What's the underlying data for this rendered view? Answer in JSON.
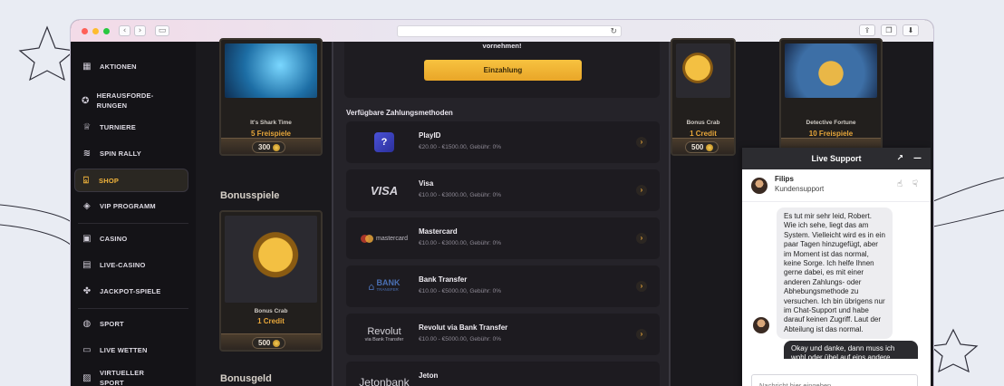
{
  "browser": {
    "traffic_lights": [
      "#ff5f57",
      "#febc2e",
      "#28c840"
    ],
    "back_glyph": "‹",
    "forward_glyph": "›",
    "reload_glyph": "↻",
    "right_icons": [
      "share-icon",
      "tabs-icon",
      "download-icon"
    ]
  },
  "sidebar": {
    "items": [
      {
        "label": "AKTIONEN",
        "icon": "gift-icon",
        "glyph": "▦"
      },
      {
        "label": "HERAUSFORDE-RUNGEN",
        "icon": "medal-icon",
        "glyph": "✪"
      },
      {
        "label": "TURNIERE",
        "icon": "trophy-icon",
        "glyph": "♕"
      },
      {
        "label": "SPIN RALLY",
        "icon": "rally-icon",
        "glyph": "≋"
      },
      {
        "label": "SHOP",
        "icon": "basket-icon",
        "glyph": "⌺",
        "active": true
      },
      {
        "label": "VIP PROGRAMM",
        "icon": "diamond-icon",
        "glyph": "◈"
      },
      {
        "label": "CASINO",
        "icon": "slot-icon",
        "glyph": "▣"
      },
      {
        "label": "LIVE-CASINO",
        "icon": "cards-icon",
        "glyph": "▤"
      },
      {
        "label": "JACKPOT-SPIELE",
        "icon": "clover-icon",
        "glyph": "✤"
      },
      {
        "label": "SPORT",
        "icon": "ball-icon",
        "glyph": "◍"
      },
      {
        "label": "LIVE WETTEN",
        "icon": "live-icon",
        "glyph": "▭"
      },
      {
        "label": "VIRTUELLER SPORT",
        "icon": "virtual-icon",
        "glyph": "▨"
      }
    ]
  },
  "games_left": {
    "card1": {
      "title": "It's Shark Time",
      "reward": "5 Freispiele",
      "price": "300"
    },
    "section_bonus": "Bonusspiele",
    "card2": {
      "title": "Bonus Crab",
      "reward": "1 Credit",
      "price": "500"
    },
    "section_money": "Bonusgeld"
  },
  "games_right": {
    "card1": {
      "title": "Bonus Crab",
      "reward": "1 Credit",
      "price": "500"
    },
    "card2": {
      "title": "Detective Fortune",
      "reward": "10 Freispiele"
    }
  },
  "modal": {
    "top_text": "vornehmen!",
    "deposit_button": "Einzahlung",
    "methods_title": "Verfügbare Zahlungsmethoden",
    "methods": [
      {
        "name": "PlayID",
        "meta": "€20.00 - €1500.00, Gebühr: 0%",
        "logo": "playid-logo"
      },
      {
        "name": "Visa",
        "meta": "€10.00 - €3000.00, Gebühr: 0%",
        "logo": "visa-logo",
        "logo_text": "VISA"
      },
      {
        "name": "Mastercard",
        "meta": "€10.00 - €3000.00, Gebühr: 0%",
        "logo": "mastercard-logo",
        "logo_text": "mastercard"
      },
      {
        "name": "Bank Transfer",
        "meta": "€10.00 - €5000.00, Gebühr: 0%",
        "logo": "bank-logo",
        "logo_text": "BANK",
        "logo_sub": "TRANSFER"
      },
      {
        "name": "Revolut via Bank Transfer",
        "meta": "€10.00 - €5000.00, Gebühr: 0%",
        "logo": "revolut-logo",
        "logo_text": "Revolut",
        "logo_sub": "via Bank Transfer"
      },
      {
        "name": "Jeton",
        "meta": "",
        "logo": "jeton-logo",
        "logo_text": "Jetonbank"
      }
    ],
    "chevron": "›"
  },
  "chat": {
    "title": "Live Support",
    "expand_glyph": "↗",
    "minimize_glyph": "—",
    "agent_name": "Filips",
    "agent_role": "Kundensupport",
    "thumb_up": "👍",
    "thumb_down": "👎",
    "message_in": "Es tut mir sehr leid, Robert. Wie ich sehe, liegt das am System. Vielleicht wird es in ein paar Tagen hinzugefügt, aber im Moment ist das normal, keine Sorge. Ich helfe Ihnen gerne dabei, es mit einer anderen Zahlungs- oder Abhebungsmethode zu versuchen. Ich bin übrigens nur im Chat-Support und habe darauf keinen Zugriff. Laut der Abteilung ist das normal.",
    "message_out": "Okay und danke, dann muss ich wohl oder übel auf eins andere",
    "input_placeholder": "Nachricht hier eingeben..."
  }
}
